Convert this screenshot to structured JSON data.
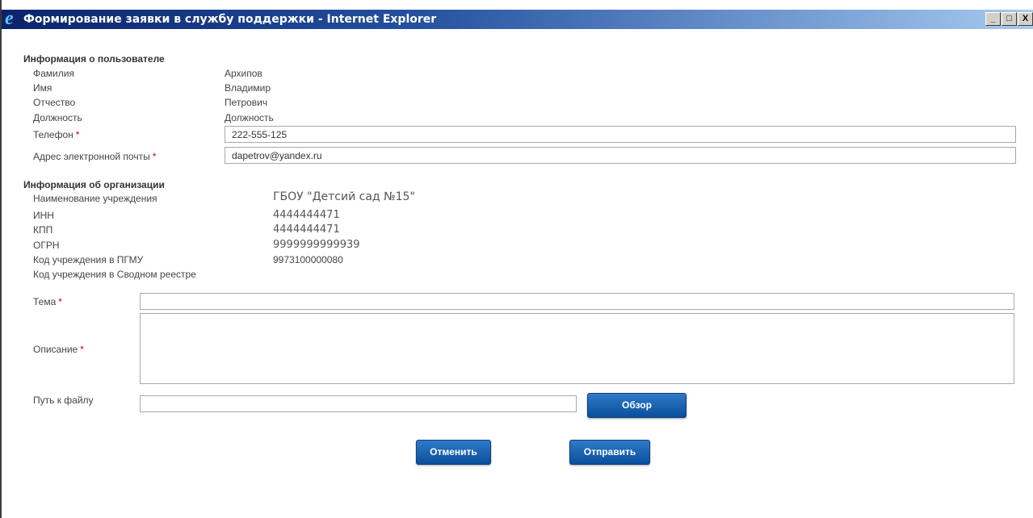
{
  "window": {
    "title": "Формирование заявки в службу поддержки - Internet Explorer",
    "controls": {
      "minimize": "_",
      "maximize": "□",
      "close": "X"
    }
  },
  "user_info": {
    "heading": "Информация о пользователе",
    "surname_label": "Фамилия",
    "surname_value": "Архипов",
    "name_label": "Имя",
    "name_value": "Владимир",
    "patronymic_label": "Отчество",
    "patronymic_value": "Петрович",
    "position_label": "Должность",
    "position_value": "Должность",
    "phone_label": "Телефон",
    "phone_value": "222-555-125",
    "email_label": "Адрес электронной почты",
    "email_value": "dapetrov@yandex.ru",
    "required_mark": "*"
  },
  "org_info": {
    "heading": "Информация об организации",
    "org_name_label": "Наименование учреждения",
    "org_name_value": "ГБОУ \"Детсий сад №15\"",
    "inn_label": "ИНН",
    "inn_value": "4444444471",
    "kpp_label": "КПП",
    "kpp_value": "4444444471",
    "ogrn_label": "ОГРН",
    "ogrn_value": "9999999999939",
    "pgmu_code_label": "Код учреждения в ПГМУ",
    "pgmu_code_value": "9973100000080",
    "registry_code_label": "Код учреждения в Сводном реестре"
  },
  "request": {
    "subject_label": "Тема",
    "subject_value": "",
    "description_label": "Описание",
    "description_value": "",
    "file_label": "Путь к файлу",
    "file_value": "",
    "browse_button": "Обзор"
  },
  "actions": {
    "cancel_button": "Отменить",
    "submit_button": "Отправить"
  },
  "colors": {
    "button": "#0a4f9c",
    "required": "#d00000",
    "titlebar": "#0a246a"
  }
}
